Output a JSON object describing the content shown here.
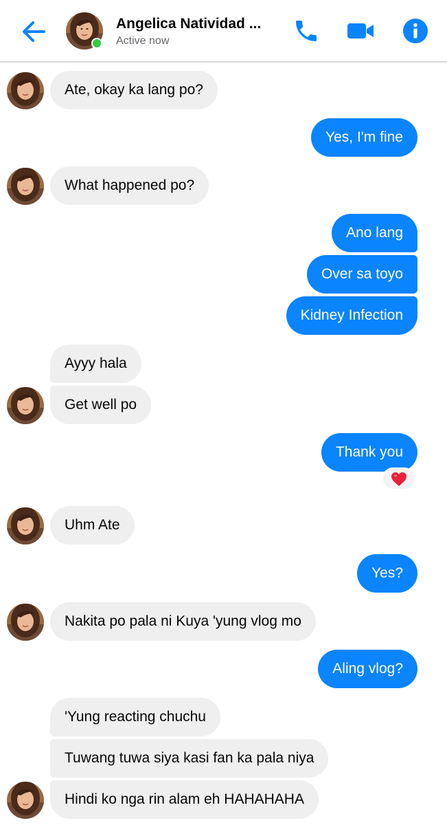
{
  "header": {
    "contact_name": "Angelica Natividad ...",
    "status": "Active now",
    "icons": {
      "back": "arrow-left-icon",
      "call": "phone-icon",
      "video": "video-camera-icon",
      "info": "info-icon"
    },
    "accent_color": "#0a84ff",
    "presence_color": "#31cc46"
  },
  "messages": [
    {
      "from": "them",
      "text": "Ate, okay ka lang po?"
    },
    {
      "from": "me",
      "text": "Yes, I'm fine"
    },
    {
      "from": "them",
      "text": "What happened po?"
    },
    {
      "from": "me",
      "text": "Ano lang"
    },
    {
      "from": "me",
      "text": "Over sa toyo"
    },
    {
      "from": "me",
      "text": "Kidney Infection"
    },
    {
      "from": "them",
      "text": "Ayyy hala"
    },
    {
      "from": "them",
      "text": "Get well po"
    },
    {
      "from": "me",
      "text": "Thank you",
      "reaction": "heart"
    },
    {
      "from": "them",
      "text": "Uhm Ate"
    },
    {
      "from": "me",
      "text": "Yes?"
    },
    {
      "from": "them",
      "text": "Nakita po pala ni Kuya 'yung vlog mo"
    },
    {
      "from": "me",
      "text": "Aling vlog?"
    },
    {
      "from": "them",
      "text": "'Yung reacting chuchu"
    },
    {
      "from": "them",
      "text": "Tuwang tuwa siya kasi fan ka pala niya"
    },
    {
      "from": "them",
      "text": "Hindi ko nga rin alam eh HAHAHAHA"
    }
  ],
  "colors": {
    "outgoing_bubble": "#0a84ff",
    "incoming_bubble": "#efefef"
  }
}
